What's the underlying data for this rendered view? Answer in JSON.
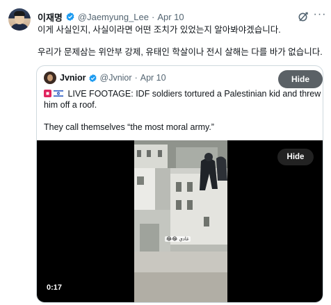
{
  "tweet": {
    "author_name": "이재명",
    "author_handle": "@Jaemyung_Lee",
    "separator": "·",
    "date": "Apr 10",
    "lines": [
      "이게 사실인지, 사실이라면 어떤 조치가 있었는지 알아봐야겠습니다.",
      "우리가 문제삼는 위안부 강제, 유태인 학살이나 전시 살해는 다를 바가 없습니다."
    ],
    "more_label": "···"
  },
  "quote": {
    "author_name": "Jvnior",
    "author_handle": "@Jvnior",
    "separator": "·",
    "date": "Apr 10",
    "hide_label": "Hide",
    "lines": [
      "LIVE FOOTAGE: IDF soldiers tortured a Palestinian kid and threw",
      "him off a roof.",
      "They call themselves “the most moral army.”"
    ],
    "flags": [
      "palestine-flag",
      "israel-flag"
    ],
    "video": {
      "hide_label": "Hide",
      "timestamp": "0:17",
      "caption_emoji": "😂😂",
      "caption_text": "غادي"
    }
  },
  "colors": {
    "verified": "#1d9bf0",
    "secondary_text": "#536471",
    "border": "#cfd9de",
    "hide_button": "#5b6166"
  },
  "icons": [
    "verified-badge-icon",
    "grok-icon",
    "more-icon"
  ]
}
